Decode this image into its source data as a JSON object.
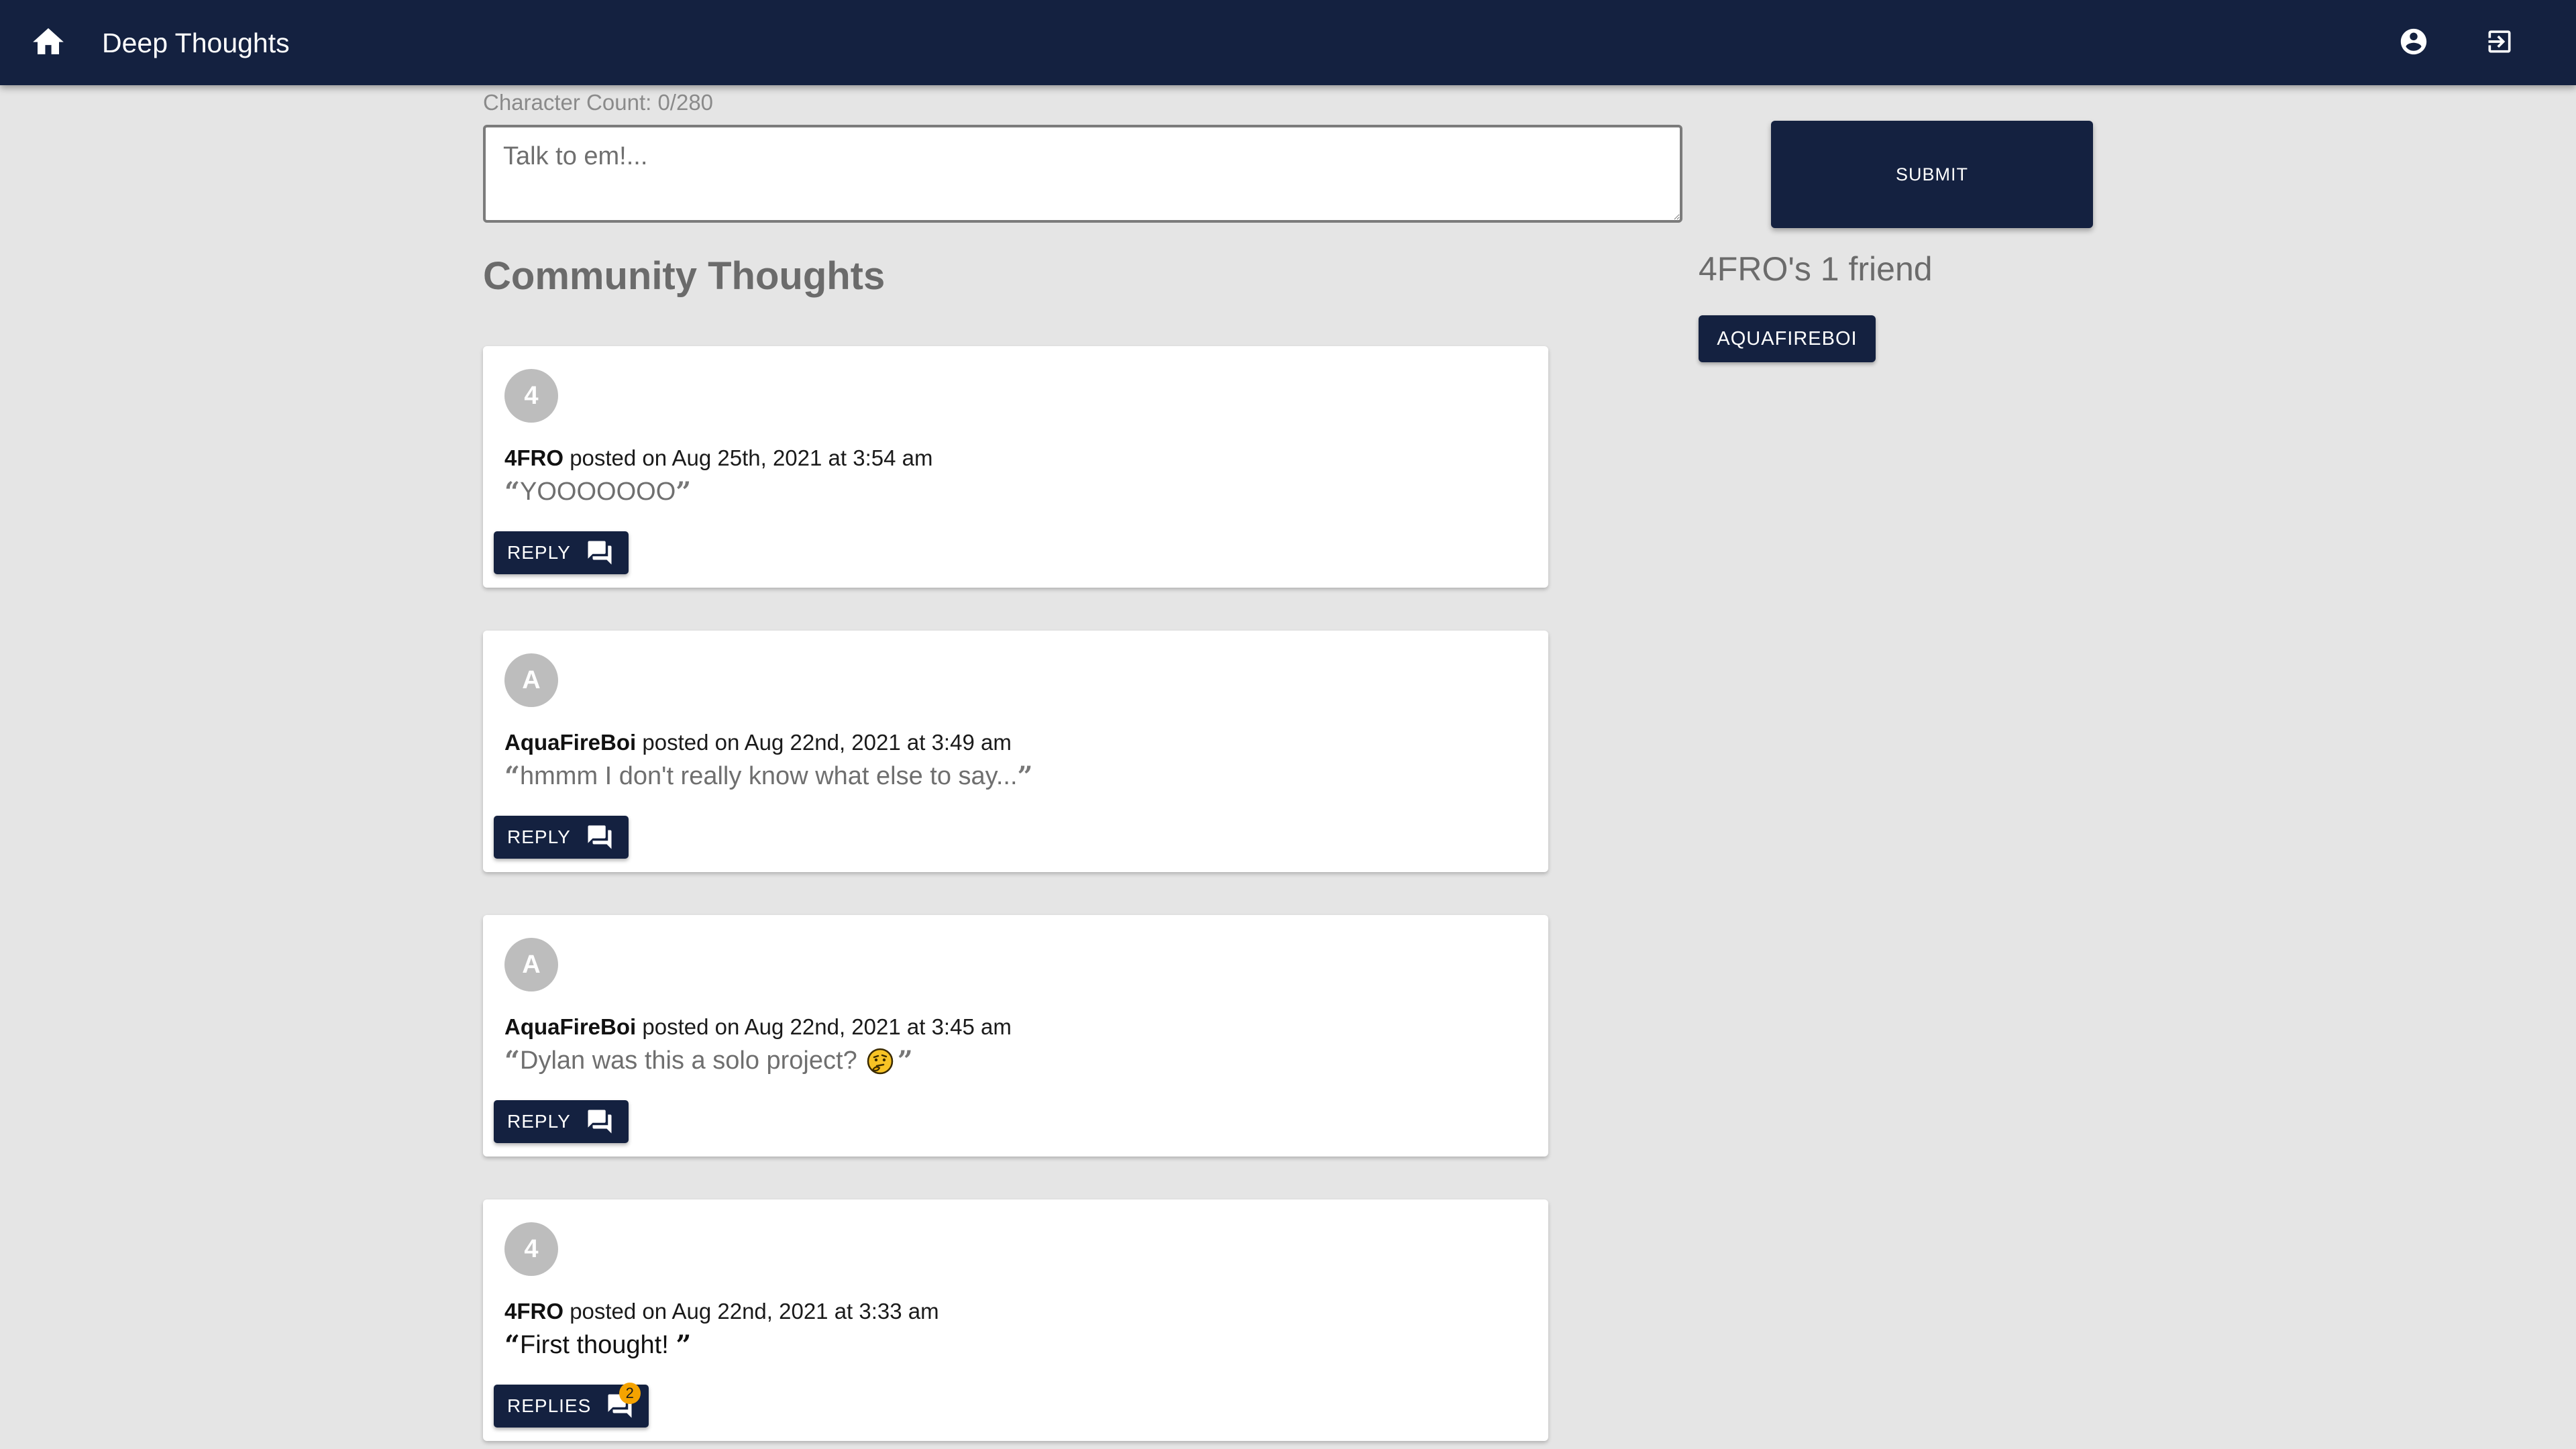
{
  "header": {
    "title": "Deep Thoughts",
    "icons": {
      "home": "home-icon",
      "account": "account-circle-icon",
      "logout": "logout-icon"
    }
  },
  "form": {
    "char_count": "Character Count: 0/280",
    "placeholder": "Talk to em!...",
    "value": "",
    "submit_label": "SUBMIT"
  },
  "feed": {
    "title": "Community Thoughts",
    "thoughts": [
      {
        "avatar_letter": "4",
        "author": "4FRO",
        "posted": "posted on Aug 25th, 2021 at 3:54 am",
        "text": "YOOOOOOO",
        "button_label": "REPLY",
        "reply_count": null
      },
      {
        "avatar_letter": "A",
        "author": "AquaFireBoi",
        "posted": "posted on Aug 22nd, 2021 at 3:49 am",
        "text": "hmmm I don't really know what else to say...",
        "button_label": "REPLY",
        "reply_count": null
      },
      {
        "avatar_letter": "A",
        "author": "AquaFireBoi",
        "posted": "posted on Aug 22nd, 2021 at 3:45 am",
        "text": "Dylan was this a solo project?",
        "emoji": "thinking-face-emoji",
        "button_label": "REPLY",
        "reply_count": null
      },
      {
        "avatar_letter": "4",
        "author": "4FRO",
        "posted": "posted on Aug 22nd, 2021 at 3:33 am",
        "text": "First thought! ",
        "button_label": "REPLIES",
        "reply_count": "2"
      }
    ]
  },
  "friends": {
    "title": "4FRO's 1 friend",
    "list": [
      "AQUAFIREBOI"
    ]
  },
  "colors": {
    "primary": "#142140",
    "background": "#e5e5e5",
    "badge": "#f5a300"
  }
}
